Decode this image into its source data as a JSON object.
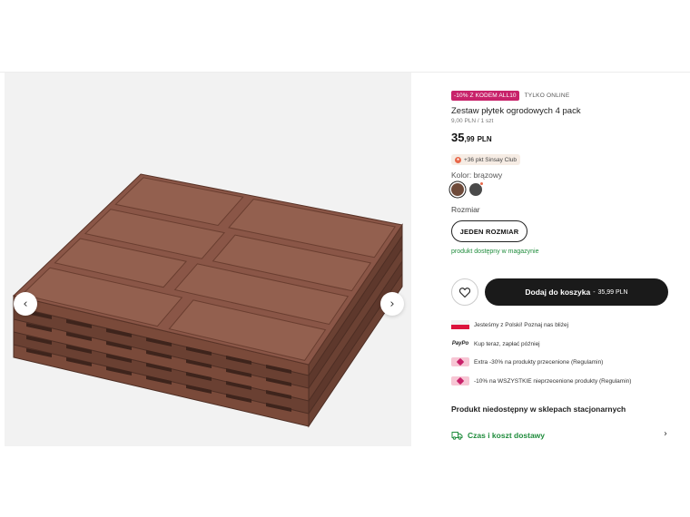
{
  "gallery": {
    "image_alt": "garden-tiles-product-photo",
    "prev_icon": "chevron-left-icon",
    "next_icon": "chevron-right-icon",
    "prev_glyph": "‹",
    "next_glyph": "›"
  },
  "product": {
    "promo_badge": "-10% Z KODEM ALL10",
    "online_tag": "TYLKO ONLINE",
    "title": "Zestaw płytek ogrodowych 4 pack",
    "unit_price": "9,00 PLN / 1 szt",
    "price_int": "35",
    "price_dec": ",99",
    "currency": "PLN",
    "club_points": "+36 pkt Sinsay Club",
    "color_label": "Kolor: brązowy",
    "size_label": "Rozmiar",
    "size_option": "JEDEN ROZMIAR",
    "availability": "produkt dostępny w magazynie",
    "cart_label": "Dodaj do koszyka",
    "cart_separator": "-",
    "cart_price": "35,99 PLN",
    "colors": {
      "accent": "#c8226a",
      "available": "#1f8c3c",
      "primary_button": "#1a1a1a",
      "swatch_brown": "#6e4a3a",
      "swatch_grey": "#4a4a4a"
    }
  },
  "features": [
    {
      "icon": "poland-flag-icon",
      "text": "Jesteśmy z Polski! Poznaj nas bliżej"
    },
    {
      "icon": "paypo-icon",
      "icon_text": "PayPo",
      "text": "Kup teraz, zapłać później"
    },
    {
      "icon": "discount-tag-icon",
      "text": "Extra -30% na produkty przecenione (Regulamin)"
    },
    {
      "icon": "discount-tag-icon",
      "text": "-10% na WSZYSTKIE nieprzecenione produkty (Regulamin)"
    }
  ],
  "store_notice": "Produkt niedostępny w sklepach stacjonarnych",
  "delivery": {
    "label": "Czas i koszt dostawy",
    "chevron": "›"
  }
}
